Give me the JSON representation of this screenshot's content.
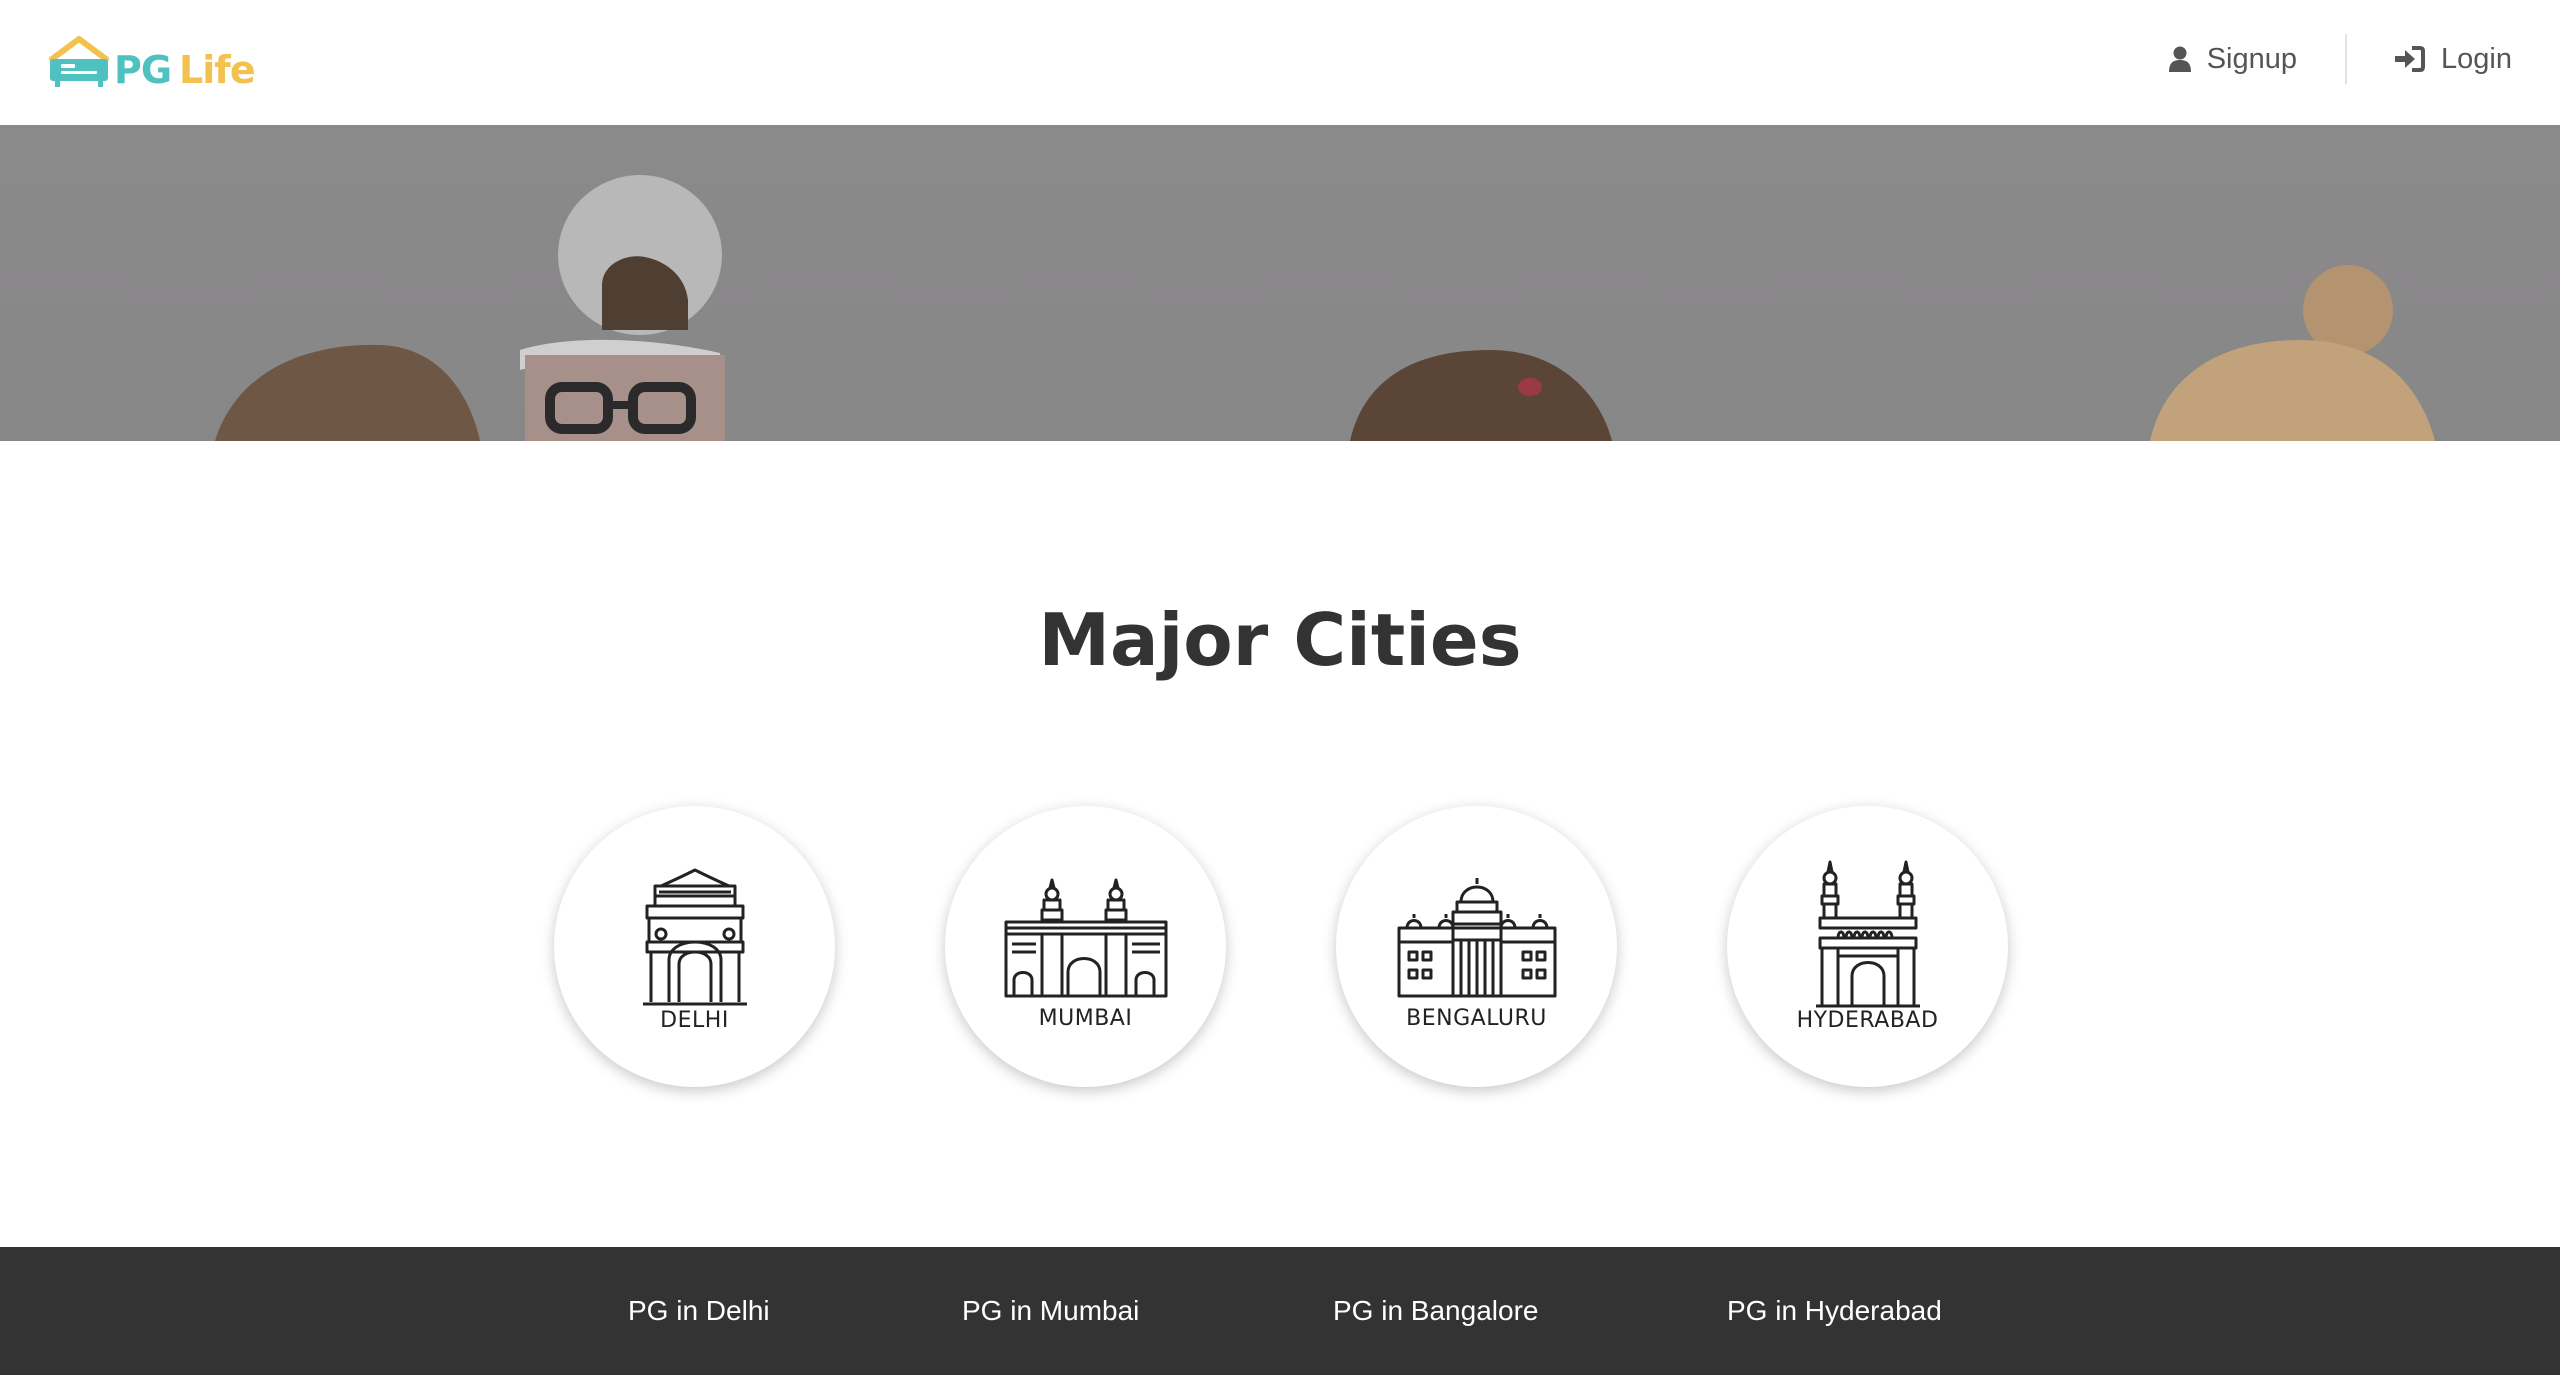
{
  "brand": {
    "name_pg": "PG",
    "name_life": "Life",
    "colors": {
      "teal": "#4fc1c0",
      "yellow": "#f2c14e"
    }
  },
  "nav": {
    "signup_label": "Signup",
    "login_label": "Login",
    "signup_icon": "user-icon",
    "login_icon": "sign-in-icon"
  },
  "main": {
    "title": "Major Cities",
    "cities": [
      {
        "name": "DELHI",
        "icon": "india-gate-icon"
      },
      {
        "name": "MUMBAI",
        "icon": "gateway-of-india-icon"
      },
      {
        "name": "BENGALURU",
        "icon": "vidhana-soudha-icon"
      },
      {
        "name": "HYDERABAD",
        "icon": "charminar-icon"
      }
    ]
  },
  "footer": {
    "links": [
      "PG in Delhi",
      "PG in Mumbai",
      "PG in Bangalore",
      "PG in Hyderabad"
    ],
    "background": "#333333"
  }
}
